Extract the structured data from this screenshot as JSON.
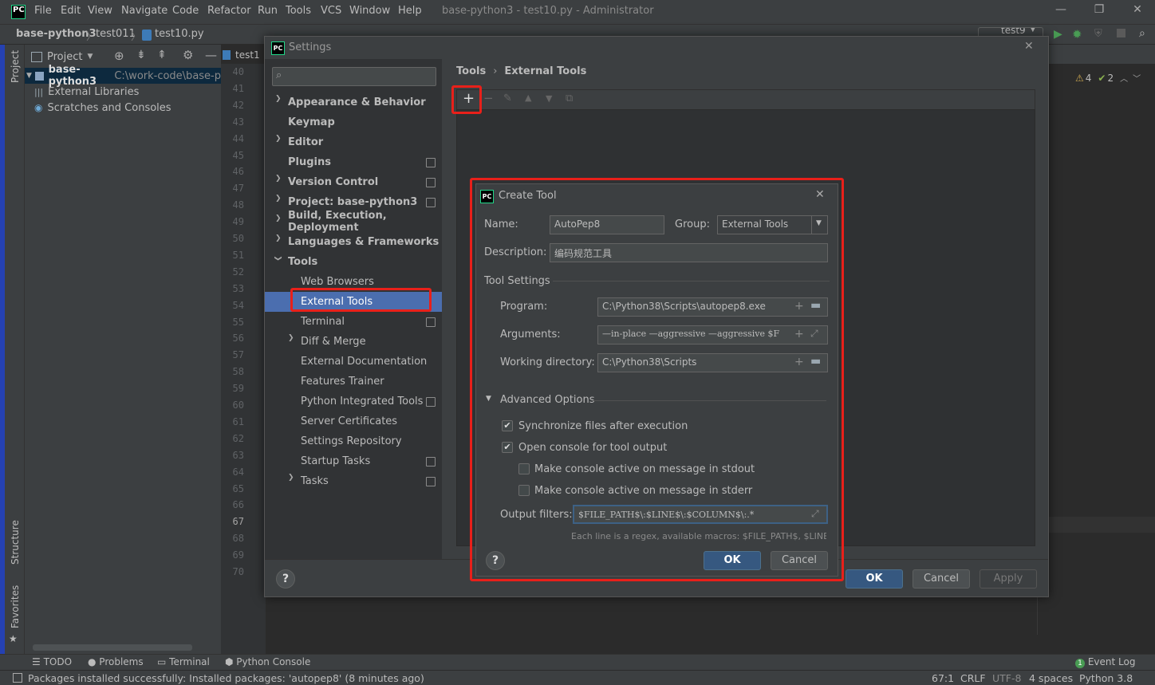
{
  "menubar": {
    "items": [
      "File",
      "Edit",
      "View",
      "Navigate",
      "Code",
      "Refactor",
      "Run",
      "Tools",
      "VCS",
      "Window",
      "Help"
    ],
    "window_title": "base-python3 - test10.py - Administrator"
  },
  "navbar": {
    "crumbs": [
      "base-python3",
      "test011",
      "test10.py"
    ],
    "run_config": "test9"
  },
  "left_strip": {
    "project": "Project",
    "structure": "Structure",
    "favorites": "Favorites"
  },
  "project_panel": {
    "title": "Project",
    "tree": {
      "root_name": "base-python3",
      "root_path": "C:\\work-code\\base-p",
      "libs": "External Libraries",
      "scratches": "Scratches and Consoles"
    }
  },
  "editor": {
    "tab": "test1",
    "line_numbers": [
      "40",
      "41",
      "42",
      "43",
      "44",
      "45",
      "46",
      "47",
      "48",
      "49",
      "50",
      "51",
      "52",
      "53",
      "54",
      "55",
      "56",
      "57",
      "58",
      "59",
      "60",
      "61",
      "62",
      "63",
      "64",
      "65",
      "66",
      "67",
      "68",
      "69",
      "70"
    ],
    "warnings": "4",
    "weak_warnings": "2"
  },
  "settings": {
    "title": "Settings",
    "search_placeholder": "",
    "nav": [
      {
        "label": "Appearance & Behavior",
        "bold": true,
        "arrow": "›",
        "level": 0
      },
      {
        "label": "Keymap",
        "bold": true,
        "arrow": "",
        "level": 0
      },
      {
        "label": "Editor",
        "bold": true,
        "arrow": "›",
        "level": 0
      },
      {
        "label": "Plugins",
        "bold": true,
        "arrow": "",
        "level": 0,
        "cfg": true
      },
      {
        "label": "Version Control",
        "bold": true,
        "arrow": "›",
        "level": 0,
        "cfg": true
      },
      {
        "label": "Project: base-python3",
        "bold": true,
        "arrow": "›",
        "level": 0,
        "cfg": true
      },
      {
        "label": "Build, Execution, Deployment",
        "bold": true,
        "arrow": "›",
        "level": 0
      },
      {
        "label": "Languages & Frameworks",
        "bold": true,
        "arrow": "›",
        "level": 0
      },
      {
        "label": "Tools",
        "bold": true,
        "arrow": "⌄",
        "level": 0
      },
      {
        "label": "Web Browsers",
        "bold": false,
        "arrow": "",
        "level": 1
      },
      {
        "label": "External Tools",
        "bold": false,
        "arrow": "",
        "level": 1,
        "selected": true
      },
      {
        "label": "Terminal",
        "bold": false,
        "arrow": "",
        "level": 1,
        "cfg": true
      },
      {
        "label": "Diff & Merge",
        "bold": false,
        "arrow": "›",
        "level": 1
      },
      {
        "label": "External Documentation",
        "bold": false,
        "arrow": "",
        "level": 1
      },
      {
        "label": "Features Trainer",
        "bold": false,
        "arrow": "",
        "level": 1
      },
      {
        "label": "Python Integrated Tools",
        "bold": false,
        "arrow": "",
        "level": 1,
        "cfg": true
      },
      {
        "label": "Server Certificates",
        "bold": false,
        "arrow": "",
        "level": 1
      },
      {
        "label": "Settings Repository",
        "bold": false,
        "arrow": "",
        "level": 1
      },
      {
        "label": "Startup Tasks",
        "bold": false,
        "arrow": "",
        "level": 1,
        "cfg": true
      },
      {
        "label": "Tasks",
        "bold": false,
        "arrow": "›",
        "level": 1,
        "cfg": true
      }
    ],
    "breadcrumb_parent": "Tools",
    "breadcrumb_sep": "›",
    "breadcrumb_current": "External Tools",
    "buttons": {
      "ok": "OK",
      "cancel": "Cancel",
      "apply": "Apply",
      "help": "?"
    }
  },
  "create_tool": {
    "title": "Create Tool",
    "name_label": "Name:",
    "name_value": "AutoPep8",
    "group_label": "Group:",
    "group_value": "External Tools",
    "description_label": "Description:",
    "description_value": "编码规范工具",
    "tool_settings_label": "Tool Settings",
    "program_label": "Program:",
    "program_value": "C:\\Python38\\Scripts\\autopep8.exe",
    "arguments_label": "Arguments:",
    "arguments_value": "—in-place —aggressive —aggressive $F",
    "workdir_label": "Working directory:",
    "workdir_value": "C:\\Python38\\Scripts",
    "advanced_label": "Advanced Options",
    "sync_label": "Synchronize files after execution",
    "sync_checked": true,
    "console_label": "Open console for tool output",
    "console_checked": true,
    "stdout_label": "Make console active on message in stdout",
    "stdout_checked": false,
    "stderr_label": "Make console active on message in stderr",
    "stderr_checked": false,
    "output_filters_label": "Output filters:",
    "output_filters_value": "$FILE_PATH$\\:$LINE$\\:$COLUMN$\\:.*",
    "hint": "Each line is a regex, available macros: $FILE_PATH$, $LINE$ ...",
    "ok": "OK",
    "cancel": "Cancel",
    "help": "?"
  },
  "bottom_bar": {
    "todo": "TODO",
    "problems": "Problems",
    "terminal": "Terminal",
    "python_console": "Python Console",
    "event_log": "Event Log",
    "event_count": "1"
  },
  "status_bar": {
    "message": "Packages installed successfully: Installed packages: 'autopep8' (8 minutes ago)",
    "position": "67:1",
    "line_sep": "CRLF",
    "encoding": "UTF-8",
    "indent": "4 spaces",
    "interpreter": "Python 3.8"
  },
  "colors": {
    "accent": "#4b6eaf",
    "highlight_box": "#e8201a",
    "primary_button": "#365880"
  }
}
